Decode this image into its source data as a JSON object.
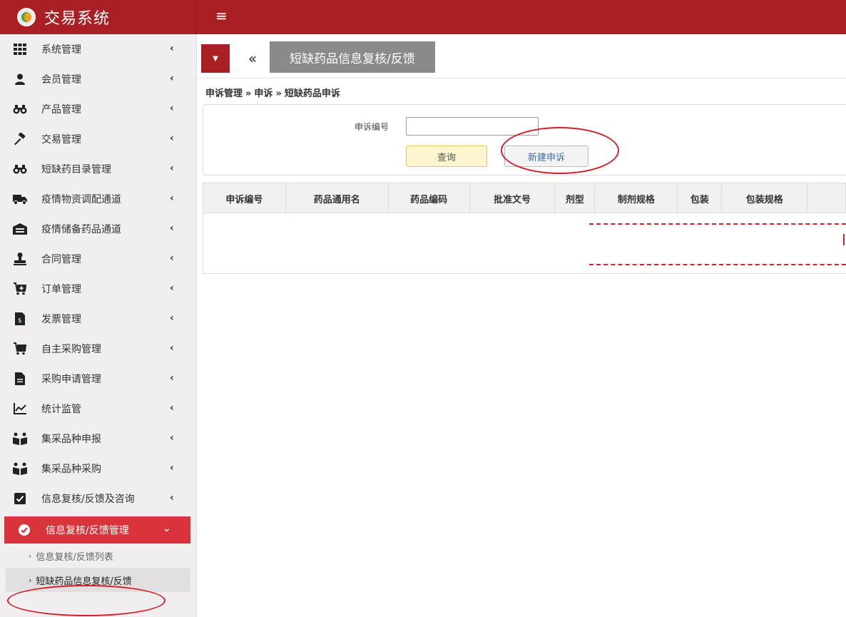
{
  "app": {
    "title": "交易系统"
  },
  "sidebar": {
    "items": [
      {
        "label": "系统管理",
        "icon": "grid-icon"
      },
      {
        "label": "会员管理",
        "icon": "user-icon"
      },
      {
        "label": "产品管理",
        "icon": "binoculars-icon"
      },
      {
        "label": "交易管理",
        "icon": "gavel-icon"
      },
      {
        "label": "短缺药目录管理",
        "icon": "binoculars-icon"
      },
      {
        "label": "疫情物资调配通道",
        "icon": "truck-icon"
      },
      {
        "label": "疫情储备药品通道",
        "icon": "warehouse-icon"
      },
      {
        "label": "合同管理",
        "icon": "stamp-icon"
      },
      {
        "label": "订单管理",
        "icon": "cart-plus-icon"
      },
      {
        "label": "发票管理",
        "icon": "invoice-icon"
      },
      {
        "label": "自主采购管理",
        "icon": "cart-icon"
      },
      {
        "label": "采购申请管理",
        "icon": "file-icon"
      },
      {
        "label": "统计监管",
        "icon": "line-chart-icon"
      },
      {
        "label": "集采品种申报",
        "icon": "people-book-icon"
      },
      {
        "label": "集采品种采购",
        "icon": "people-book-icon"
      },
      {
        "label": "信息复核/反馈及咨询",
        "icon": "check-square-icon"
      }
    ],
    "active": {
      "label": "信息复核/反馈管理",
      "icon": "check-circle-icon"
    },
    "subitems": [
      {
        "label": "信息复核/反馈列表"
      },
      {
        "label": "短缺药品信息复核/反馈"
      }
    ]
  },
  "tabs": {
    "active_label": "短缺药品信息复核/反馈"
  },
  "breadcrumb": [
    "申诉管理",
    "申诉",
    "短缺药品申诉"
  ],
  "breadcrumb_sep": "»",
  "search": {
    "label": "申诉编号",
    "value": "",
    "query_button": "查询",
    "new_button": "新建申诉"
  },
  "table": {
    "columns": [
      "申诉编号",
      "药品通用名",
      "药品编码",
      "批准文号",
      "剂型",
      "制剂规格",
      "包装",
      "包装规格",
      ""
    ]
  },
  "colors": {
    "brand": "#a91f23",
    "active": "#d9343b",
    "annotation": "#d4202a"
  }
}
